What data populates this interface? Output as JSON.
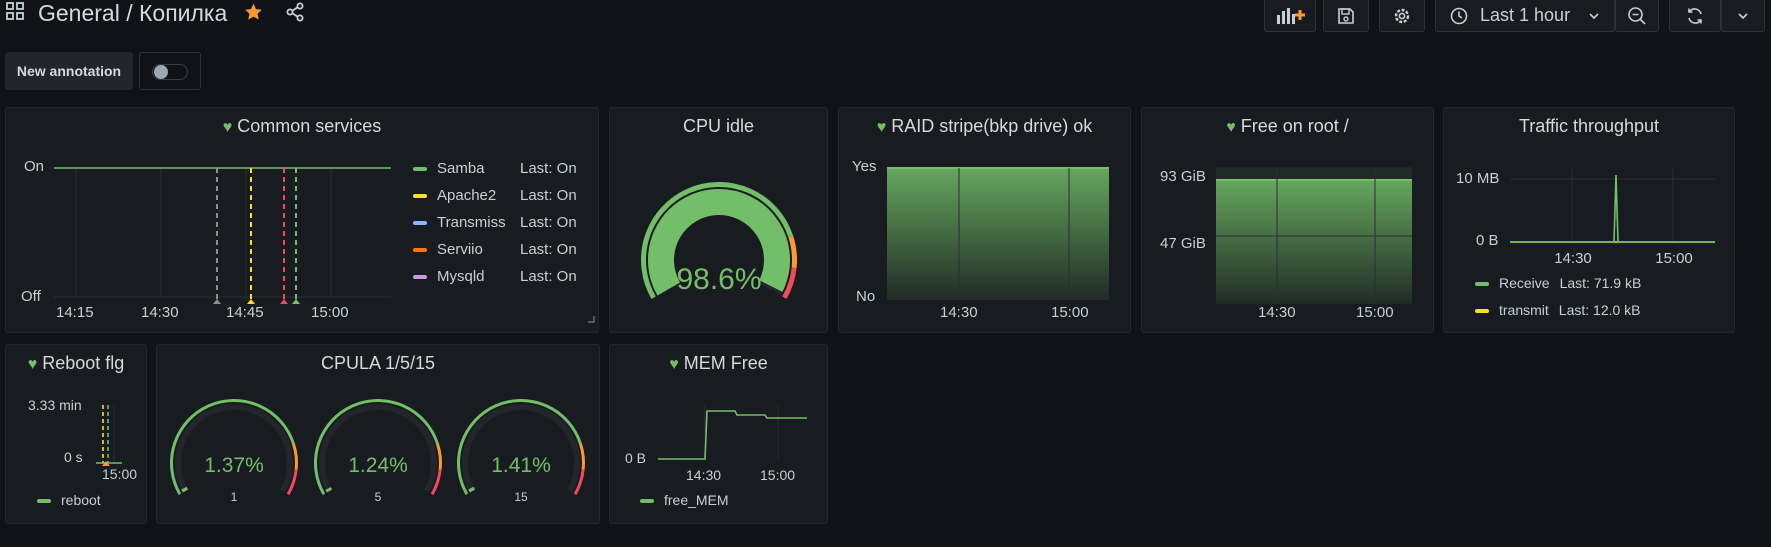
{
  "header": {
    "folder": "General",
    "separator": " / ",
    "dashboard": "Копилка",
    "time_range": "Last 1 hour",
    "annotation_button": "New annotation"
  },
  "colors": {
    "green": "#73bf69",
    "yellow": "#fade2a",
    "blue": "#8ab8ff",
    "orange": "#ff780a",
    "purple": "#ca95e5",
    "red": "#f2495c",
    "star": "#ff9830"
  },
  "panels": {
    "common": {
      "title": "Common services",
      "y_top": "On",
      "y_bottom": "Off",
      "x_ticks": [
        "14:15",
        "14:30",
        "14:45",
        "15:00"
      ],
      "legend": [
        {
          "name": "Samba",
          "last": "Last: On"
        },
        {
          "name": "Apache2",
          "last": "Last: On"
        },
        {
          "name": "Transmiss",
          "last": "Last: On"
        },
        {
          "name": "Serviio",
          "last": "Last: On"
        },
        {
          "name": "Mysqld",
          "last": "Last: On"
        }
      ]
    },
    "cpu_idle": {
      "title": "CPU idle",
      "value": "98.6%",
      "fraction": 0.986
    },
    "raid": {
      "title": "RAID stripe(bkp drive) ok",
      "y_top": "Yes",
      "y_bottom": "No",
      "x_ticks": [
        "14:30",
        "15:00"
      ]
    },
    "free_root": {
      "title": "Free on root /",
      "y_ticks": [
        "93 GiB",
        "47 GiB"
      ],
      "x_ticks": [
        "14:30",
        "15:00"
      ]
    },
    "traffic": {
      "title": "Traffic throughput",
      "y_ticks": [
        "10 MB",
        "0 B"
      ],
      "x_ticks": [
        "14:30",
        "15:00"
      ],
      "legend": [
        {
          "name": "Receive",
          "last": "Last: 71.9 kB"
        },
        {
          "name": "transmit",
          "last": "Last: 12.0 kB"
        }
      ]
    },
    "reboot": {
      "title": "Reboot flg",
      "y_ticks": [
        "3.33 min",
        "0 s"
      ],
      "x_tick": "15:00",
      "legend": "reboot"
    },
    "cpula": {
      "title": "CPULA 1/5/15",
      "gauges": [
        {
          "value": "1.37%",
          "label": "1",
          "fraction": 0.0137
        },
        {
          "value": "1.24%",
          "label": "5",
          "fraction": 0.0124
        },
        {
          "value": "1.41%",
          "label": "15",
          "fraction": 0.0141
        }
      ]
    },
    "mem": {
      "title": "MEM Free",
      "y_tick": "0 B",
      "x_ticks": [
        "14:30",
        "15:00"
      ],
      "legend": "free_MEM"
    }
  }
}
